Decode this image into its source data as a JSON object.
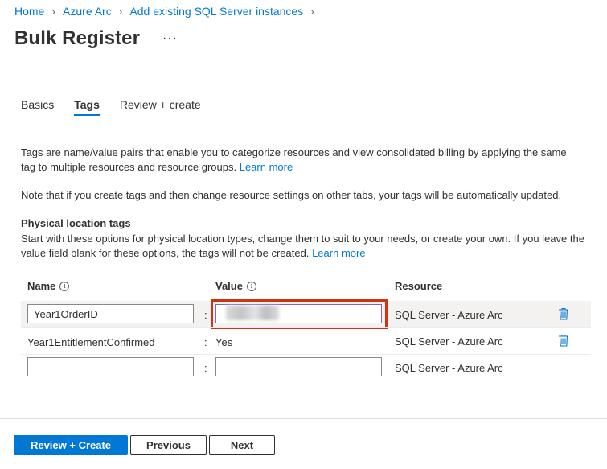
{
  "breadcrumb": [
    {
      "label": "Home"
    },
    {
      "label": "Azure Arc"
    },
    {
      "label": "Add existing SQL Server instances"
    }
  ],
  "page_title": "Bulk Register",
  "more_label": "···",
  "tabs": [
    {
      "label": "Basics",
      "active": false
    },
    {
      "label": "Tags",
      "active": true
    },
    {
      "label": "Review + create",
      "active": false
    }
  ],
  "intro": {
    "text": "Tags are name/value pairs that enable you to categorize resources and view consolidated billing by applying the same tag to multiple resources and resource groups.",
    "link": "Learn more"
  },
  "note": "Note that if you create tags and then change resource settings on other tabs, your tags will be automatically updated.",
  "physical": {
    "title": "Physical location tags",
    "text": "Start with these options for physical location types, change them to suit to your needs, or create your own. If you leave the value field blank for these options, the tags will not be created.",
    "link": "Learn more"
  },
  "grid": {
    "headers": {
      "name": "Name",
      "value": "Value",
      "resource": "Resource"
    },
    "info_icon": "i",
    "separator": ":",
    "rows": [
      {
        "name": "Year1OrderID",
        "value": "",
        "resource": "SQL Server - Azure Arc",
        "editable": true,
        "deletable": true
      },
      {
        "name": "Year1EntitlementConfirmed",
        "value": "Yes",
        "resource": "SQL Server - Azure Arc",
        "editable": false,
        "deletable": true
      },
      {
        "name": "",
        "value": "",
        "resource": "SQL Server - Azure Arc",
        "editable": true,
        "deletable": false
      }
    ]
  },
  "footer": {
    "review_create": "Review + Create",
    "previous": "Previous",
    "next": "Next"
  },
  "icons": {
    "chevron": "chevron-right-icon",
    "info": "info-icon",
    "delete": "trash-icon"
  },
  "colors": {
    "accent": "#0078d4",
    "highlight": "#d13212",
    "selected_row": "#f3f2f1"
  }
}
